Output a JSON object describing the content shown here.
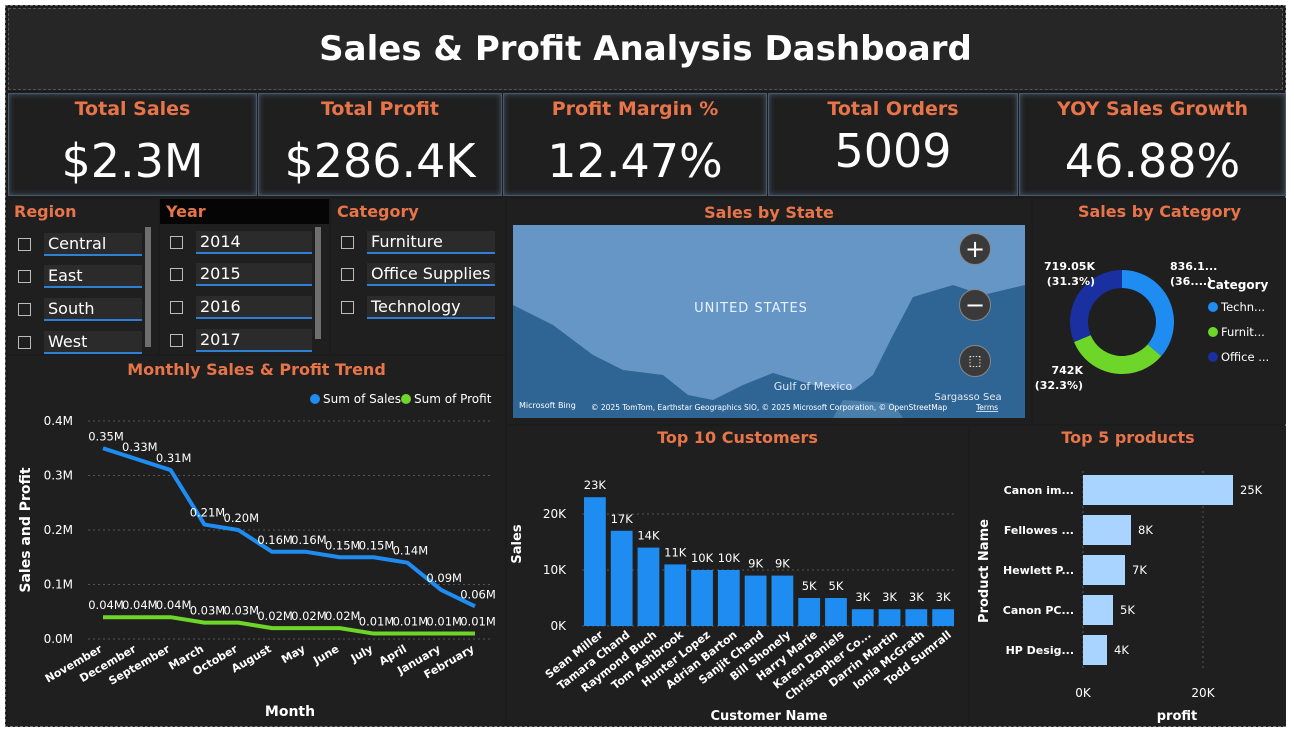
{
  "title": "Sales & Profit Analysis Dashboard",
  "kpis": [
    {
      "label": "Total Sales",
      "value": "$2.3M"
    },
    {
      "label": "Total Profit",
      "value": "$286.4K"
    },
    {
      "label": "Profit Margin %",
      "value": "12.47%"
    },
    {
      "label": "Total Orders",
      "value": "5009"
    },
    {
      "label": "YOY Sales Growth",
      "value": "46.88%"
    }
  ],
  "slicers": {
    "region": {
      "title": "Region",
      "items": [
        "Central",
        "East",
        "South",
        "West"
      ]
    },
    "year": {
      "title": "Year",
      "items": [
        "2014",
        "2015",
        "2016",
        "2017"
      ]
    },
    "category": {
      "title": "Category",
      "items": [
        "Furniture",
        "Office Supplies",
        "Technology"
      ]
    }
  },
  "map": {
    "title": "Sales by State",
    "labels": {
      "country": "UNITED STATES",
      "gulf": "Gulf of Mexico",
      "sea": "Sargasso Sea"
    },
    "attribution": "© 2025 TomTom, Earthstar Geographics SIO, © 2025 Microsoft Corporation, © OpenStreetMap",
    "terms": "Terms",
    "brand": "Microsoft Bing",
    "controls": {
      "zoom_in": "+",
      "zoom_out": "−"
    }
  },
  "colors": {
    "accent_orange": "#e8744a",
    "sales_blue": "#1e8cf0",
    "profit_green": "#6ed628",
    "office_navy": "#1a2fa0",
    "bar_light": "#a8d4ff"
  },
  "chart_data": [
    {
      "type": "line",
      "title": "Monthly Sales & Profit Trend",
      "xlabel": "Month",
      "ylabel": "Sales and Profit",
      "categories": [
        "November",
        "December",
        "September",
        "March",
        "October",
        "August",
        "May",
        "June",
        "July",
        "April",
        "January",
        "February"
      ],
      "ylim": [
        0,
        0.4
      ],
      "yticks": [
        "0.0M",
        "0.1M",
        "0.2M",
        "0.3M",
        "0.4M"
      ],
      "legend": "top-right",
      "series": [
        {
          "name": "Sum of Sales",
          "values": [
            0.35,
            0.33,
            0.31,
            0.21,
            0.2,
            0.16,
            0.16,
            0.15,
            0.15,
            0.14,
            0.09,
            0.06
          ],
          "labels": [
            "0.35M",
            "0.33M",
            "0.31M",
            "0.21M",
            "0.20M",
            "0.16M",
            "0.16M",
            "0.15M",
            "0.15M",
            "0.14M",
            "0.09M",
            "0.06M"
          ]
        },
        {
          "name": "Sum of Profit",
          "values": [
            0.04,
            0.04,
            0.04,
            0.03,
            0.03,
            0.02,
            0.02,
            0.02,
            0.01,
            0.01,
            0.01,
            0.01
          ],
          "labels": [
            "0.04M",
            "0.04M",
            "0.04M",
            "0.03M",
            "0.03M",
            "0.02M",
            "0.02M",
            "0.02M",
            "0.01M",
            "0.01M",
            "0.01M",
            "0.01M"
          ]
        }
      ]
    },
    {
      "type": "pie",
      "title": "Sales by Category",
      "legend_title": "Category",
      "slices": [
        {
          "name": "Techn...",
          "value": 836.1,
          "label": "836.1...",
          "pct": "(36....)"
        },
        {
          "name": "Furnit...",
          "value": 742,
          "label": "742K",
          "pct": "(32.3%)"
        },
        {
          "name": "Office ...",
          "value": 719.05,
          "label": "719.05K",
          "pct": "(31.3%)"
        }
      ]
    },
    {
      "type": "bar",
      "title": "Top 10 Customers",
      "xlabel": "Customer Name",
      "ylabel": "Sales",
      "categories": [
        "Sean Miller",
        "Tamara Chand",
        "Raymond Buch",
        "Tom Ashbrook",
        "Hunter Lopez",
        "Adrian Barton",
        "Sanjit Chand",
        "Bill Shonely",
        "Harry Marie",
        "Karen Daniels",
        "Christopher Co...",
        "Darrin Martin",
        "Ionia McGrath",
        "Todd Sumrall"
      ],
      "values": [
        23,
        17,
        14,
        11,
        10,
        10,
        9,
        9,
        5,
        5,
        3,
        3,
        3,
        3
      ],
      "labels": [
        "23K",
        "17K",
        "14K",
        "11K",
        "10K",
        "10K",
        "9K",
        "9K",
        "5K",
        "5K",
        "3K",
        "3K",
        "3K",
        "3K"
      ],
      "ylim": [
        0,
        25
      ],
      "yticks": [
        "0K",
        "10K",
        "20K"
      ]
    },
    {
      "type": "bar",
      "orientation": "horizontal",
      "title": "Top 5 products",
      "xlabel": "profit",
      "ylabel": "Product Name",
      "categories": [
        "Canon im...",
        "Fellowes ...",
        "Hewlett P...",
        "Canon PC...",
        "HP Desig..."
      ],
      "values": [
        25,
        8,
        7,
        5,
        4
      ],
      "labels": [
        "25K",
        "8K",
        "7K",
        "5K",
        "4K"
      ],
      "xlim": [
        0,
        25
      ],
      "xticks": [
        "0K",
        "20K"
      ]
    }
  ]
}
